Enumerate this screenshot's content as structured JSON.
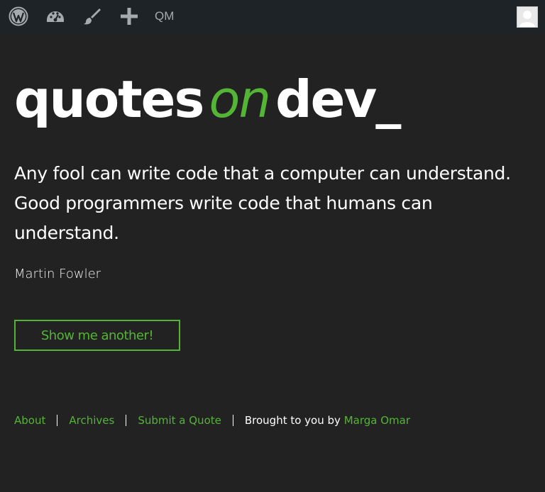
{
  "admin_bar": {
    "icons": [
      "wordpress-logo-icon",
      "dashboard-gauge-icon",
      "paintbrush-icon",
      "plus-icon"
    ],
    "qm_label": "QM",
    "avatar": "user-avatar"
  },
  "site": {
    "title_part1": "quotes",
    "title_part2": "on",
    "title_part3": "dev_"
  },
  "quote": {
    "text": "Any fool can write code that a computer can understand. Good programmers write code that humans can understand.",
    "author": "Martin Fowler"
  },
  "button": {
    "label": "Show me another!"
  },
  "footer": {
    "links": [
      "About",
      "Archives",
      "Submit a Quote"
    ],
    "credit_prefix": "Brought to you by",
    "credit_name": "Marga Omar"
  },
  "colors": {
    "accent": "#54b435",
    "background": "#222222",
    "admin_bar": "#1d2327"
  }
}
